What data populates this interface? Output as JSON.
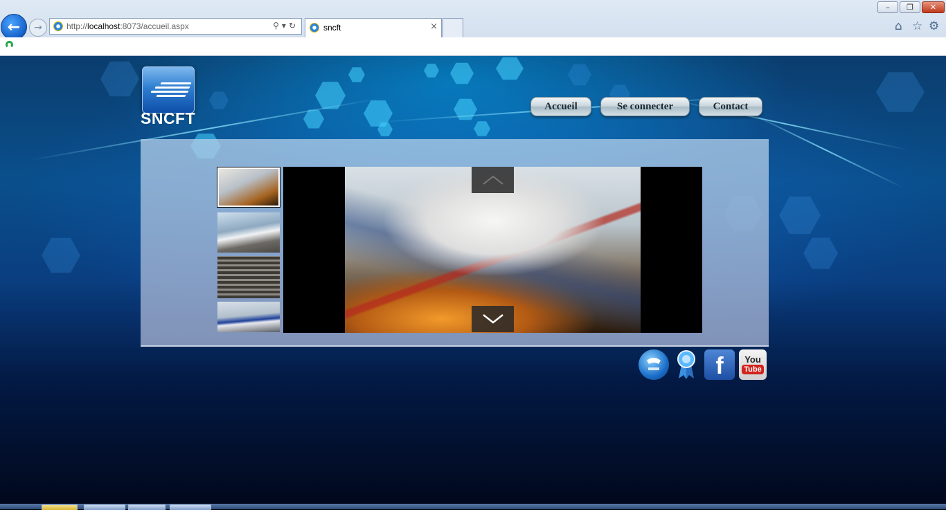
{
  "browser": {
    "address": {
      "prefix": "http://",
      "host": "localhost",
      "rest": ":8073/accueil.aspx"
    },
    "tab": {
      "title": "sncft",
      "close_glyph": "×"
    },
    "window_controls": {
      "minimize": "–",
      "maximize": "❐",
      "close": "✕"
    },
    "icons": {
      "back": "back-arrow-icon",
      "forward": "forward-arrow-icon",
      "home": "home-icon",
      "favorites": "star-icon",
      "tools": "gear-icon"
    },
    "glyphs": {
      "back": "←",
      "forward": "→",
      "search": "⚲",
      "dropdown": "▾",
      "refresh": "↻",
      "home": "⌂",
      "star": "☆",
      "gear": "⚙"
    }
  },
  "site": {
    "logo_text": "SNCFT",
    "nav": [
      {
        "label": "Accueil"
      },
      {
        "label": "Se connecter"
      },
      {
        "label": "Contact"
      }
    ],
    "slider": {
      "thumbnails": [
        "high-speed-train-orange",
        "high-speed-train-white",
        "railway-tracks",
        "blue-white-train"
      ],
      "selected_index": 0,
      "main_image": "high-speed-train-orange"
    },
    "social_icons": [
      "phone-icon",
      "award-icon",
      "facebook-icon",
      "youtube-icon"
    ],
    "facebook_letter": "f",
    "youtube_you": "You",
    "youtube_tube": "Tube"
  },
  "colors": {
    "page_bg_top": "#0a4f8c",
    "page_bg_bottom": "#01081c",
    "accent_cyan": "#46d2ff",
    "menu_text": "#1c2a33"
  }
}
